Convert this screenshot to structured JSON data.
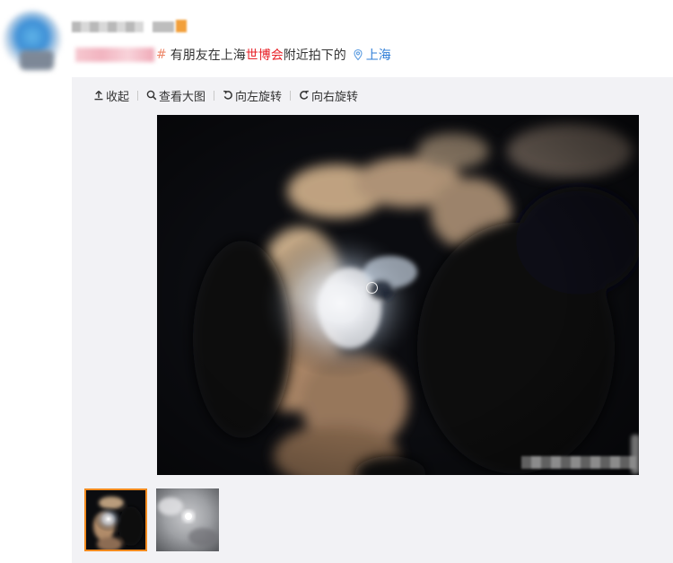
{
  "post": {
    "text_before": "有朋友在上海",
    "text_highlight": "世博会",
    "text_after": "附近拍下的",
    "hash_symbol": "#",
    "location": "上海",
    "highlight_color": "#e8242b",
    "location_color": "#2e7dd7"
  },
  "toolbar": {
    "collapse": "收起",
    "view_large": "查看大图",
    "rotate_left": "向左旋转",
    "rotate_right": "向右旋转"
  },
  "media": {
    "main_image": "night-sky-clouds-moon",
    "thumbnails": [
      {
        "name": "clouds-moon-dark",
        "selected": true
      },
      {
        "name": "moon-grey-sky",
        "selected": false
      }
    ],
    "selected_border_color": "#f28a1e"
  },
  "icons": [
    "avatar",
    "location-pin-icon",
    "collapse-up-icon",
    "search-icon",
    "rotate-left-icon",
    "rotate-right-icon"
  ]
}
